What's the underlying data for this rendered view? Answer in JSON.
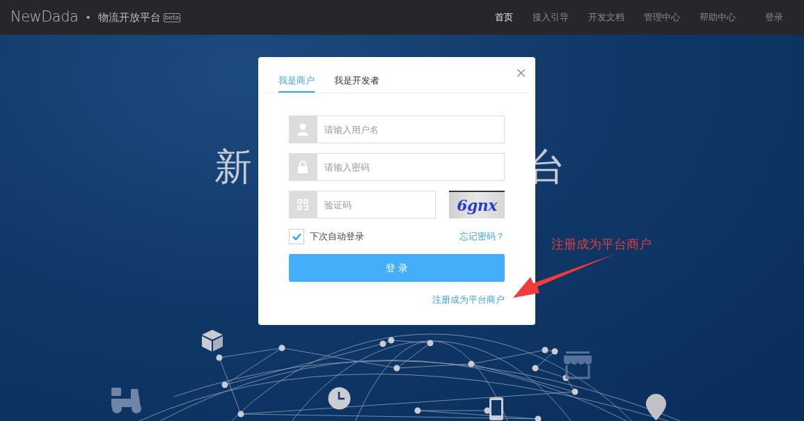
{
  "header": {
    "logo": "NewDada",
    "separator": "•",
    "site_name": "物流开放平台",
    "badge": "beta",
    "nav": [
      {
        "label": "首页",
        "selected": true
      },
      {
        "label": "接入引导",
        "selected": false
      },
      {
        "label": "开发文档",
        "selected": false
      },
      {
        "label": "管理中心",
        "selected": false
      },
      {
        "label": "帮助中心",
        "selected": false
      }
    ],
    "login": "登录"
  },
  "hero": {
    "title_left": "新",
    "title_right": "台"
  },
  "modal": {
    "close": "×",
    "tabs": [
      {
        "label": "我是商户",
        "selected": true
      },
      {
        "label": "我是开发者",
        "selected": false
      }
    ],
    "username": {
      "placeholder": "请输入用户名"
    },
    "password": {
      "placeholder": "请输入密码"
    },
    "captcha": {
      "placeholder": "验证码",
      "image_text": "6gnx"
    },
    "remember": {
      "label": "下次自动登录",
      "checked": true
    },
    "forgot": "忘记密码？",
    "submit": "登 录",
    "register": "注册成为平台商户"
  },
  "annotation": {
    "text": "注册成为平台商户"
  }
}
